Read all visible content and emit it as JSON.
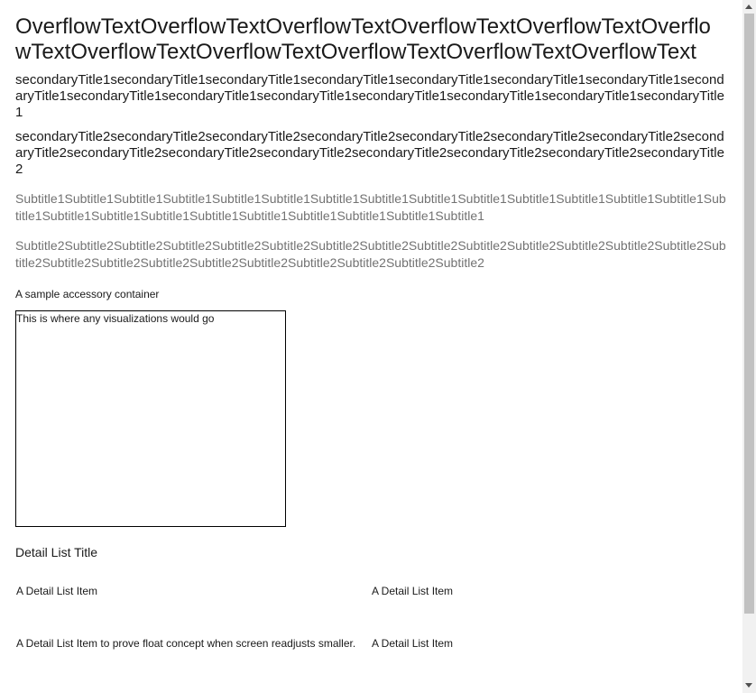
{
  "main_title": "OverflowTextOverflowTextOverflowTextOverflowTextOverflowTextOverflowTextOverflowTextOverflowTextOverflowTextOverflowTextOverflowText",
  "secondary_title_1": "secondaryTitle1secondaryTitle1secondaryTitle1secondaryTitle1secondaryTitle1secondaryTitle1secondaryTitle1secondaryTitle1secondaryTitle1secondaryTitle1secondaryTitle1secondaryTitle1secondaryTitle1secondaryTitle1secondaryTitle1",
  "secondary_title_2": "secondaryTitle2secondaryTitle2secondaryTitle2secondaryTitle2secondaryTitle2secondaryTitle2secondaryTitle2secondaryTitle2secondaryTitle2secondaryTitle2secondaryTitle2secondaryTitle2secondaryTitle2secondaryTitle2secondaryTitle2",
  "subtitle_1": "Subtitle1Subtitle1Subtitle1Subtitle1Subtitle1Subtitle1Subtitle1Subtitle1Subtitle1Subtitle1Subtitle1Subtitle1Subtitle1Subtitle1Subtitle1Subtitle1Subtitle1Subtitle1Subtitle1Subtitle1Subtitle1Subtitle1Subtitle1Subtitle1",
  "subtitle_2": "Subtitle2Subtitle2Subtitle2Subtitle2Subtitle2Subtitle2Subtitle2Subtitle2Subtitle2Subtitle2Subtitle2Subtitle2Subtitle2Subtitle2Subtitle2Subtitle2Subtitle2Subtitle2Subtitle2Subtitle2Subtitle2Subtitle2Subtitle2Subtitle2",
  "accessory_text": "A sample accessory container",
  "visualization_text": "This is where any visualizations would go",
  "detail_list": {
    "title": "Detail List Title",
    "items": [
      "A Detail List Item",
      "A Detail List Item",
      "A Detail List Item to prove float concept when screen readjusts smaller.",
      "A Detail List Item"
    ]
  },
  "colors": {
    "subtitle": "#727272",
    "text": "#1a1a1a",
    "scroll_thumb": "#c1c1c1"
  }
}
